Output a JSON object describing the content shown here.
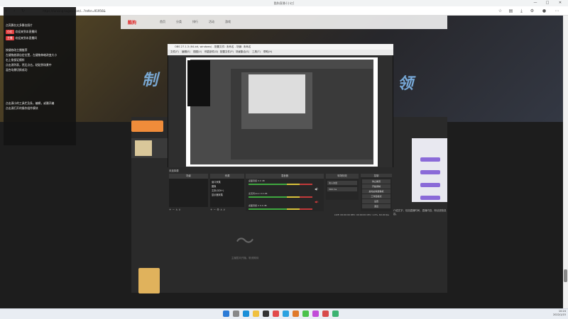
{
  "browser": {
    "window_title": "酷狗直播-[小红]",
    "url": "https://fanxing.kugou.com/...?refer=91956&",
    "controls": [
      "—",
      "□",
      "✕"
    ]
  },
  "site": {
    "logo": "酷狗",
    "nav": [
      "首页",
      "分类",
      "排行",
      "活动",
      "游戏"
    ],
    "hero_left": "制",
    "hero_right": "领",
    "empty_text": "主播暂未开播，敬请期待",
    "article": "这里显示主播的直播间介绍文字，包括直播时间、直播内容、粉丝团信息以及相关活动说明等内容。"
  },
  "chat": {
    "lines": [
      {
        "text": "点亮舞台太多舞台照片",
        "tag": ""
      },
      {
        "text": "欢迎来到本直播间",
        "tag": "小红"
      },
      {
        "text": "欢迎来到本直播间",
        "tag": "主播"
      },
      {
        "text": "按键修改主播推荐",
        "tag": ""
      },
      {
        "text": "左键拖放源自定位置，左键拖伸缩改变大小",
        "tag": ""
      },
      {
        "text": "右上角保证模样",
        "tag": ""
      },
      {
        "text": "点击源列表，然后点击，粘贴到场景中",
        "tag": ""
      },
      {
        "text": "混合场景切换成功",
        "tag": ""
      },
      {
        "text": "点击源小的工具栏及条，编辑，或删开编",
        "tag": ""
      },
      {
        "text": "点击源打开的操作组件模块",
        "tag": ""
      }
    ]
  },
  "obs": {
    "title": "OBS 27.1.3 (64-bit, windows) - 配置文件: 未命名 - 场景: 未命名",
    "menu": [
      "文件(F)",
      "编辑(E)",
      "视图(V)",
      "停靠部件(D)",
      "配置文件(P)",
      "场景集合(S)",
      "工具(T)",
      "帮助(H)"
    ],
    "docks": {
      "scenes": "场景",
      "sources": "来源",
      "mixer": "混音器",
      "transitions": "转场特效",
      "controls": "控制"
    },
    "preview_label": "未选择源",
    "sources": [
      "窗口采集",
      "图像",
      "文本(GDI+)",
      "显示器采集"
    ],
    "mixer_channels": [
      {
        "name": "桌面音频",
        "db": "0.0 dB"
      },
      {
        "name": "麦克风/Aux",
        "db": "0.0 dB"
      },
      {
        "name": "桌面音频 2",
        "db": "0.0 dB"
      }
    ],
    "transition_value": "淡入淡出",
    "duration": "300 ms",
    "controls": [
      "停止推流",
      "开始录制",
      "启动虚拟摄像机",
      "工作室模式",
      "设置",
      "退出"
    ],
    "status": "LIVE: 00:00:00   REC: 00:00:00   CPU: 1.0%, 60.00 fps"
  },
  "taskbar": {
    "time": "10:24",
    "date": "2022/1/15"
  },
  "colors": {
    "accent_red": "#e53e3e",
    "obs_bg": "#2e2e2e",
    "tag_purple": "#8a6ad8"
  }
}
